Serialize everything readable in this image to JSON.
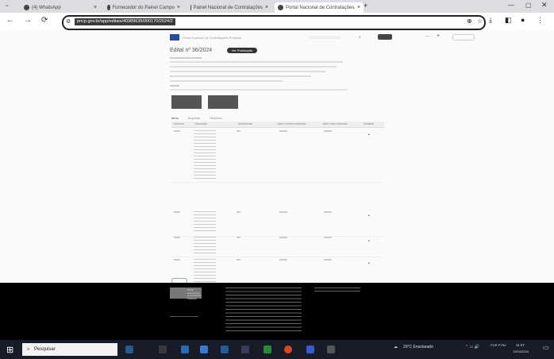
{
  "browser": {
    "tabs": [
      {
        "label": "(4) WhatsApp",
        "close": "×"
      },
      {
        "label": "Fornecedor do Painel Campo",
        "close": "×"
      },
      {
        "label": "Painel Nacional de Contratações",
        "close": "×"
      },
      {
        "label": "Portal Nacional de Contratações",
        "close": "×"
      }
    ],
    "new_tab": "+",
    "url": "pncp.gov.br/app/editais/40989635/000170/2024/2"
  },
  "page": {
    "header_title": "Portal Nacional de Contratações Públicas",
    "title": "Edital nº 36/2024",
    "badge": "Ver Publicação",
    "tabs": [
      "Itens",
      "Arquivos",
      "Histórico"
    ],
    "table_headers": [
      "Número",
      "Descrição",
      "Quantidade",
      "Valor unitário estimado",
      "Valor total estimado",
      "Detalhar"
    ]
  },
  "footer": {
    "logo_text": "Portal Nacional de Contratações Públicas",
    "detail_icon": "•"
  },
  "taskbar": {
    "search_placeholder": "Pesquisar",
    "weather": "29°C Ensolarado",
    "lang": "POR PTB2",
    "time": "11:47",
    "date": "10/04/2024"
  }
}
